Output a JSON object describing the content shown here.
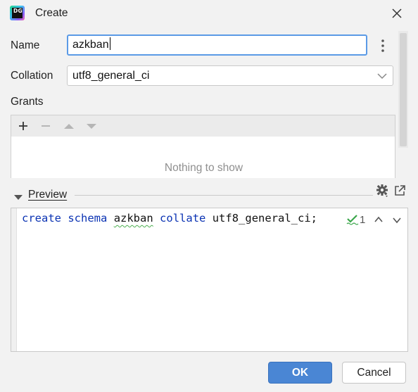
{
  "window": {
    "title": "Create",
    "app_logo_text": "DG"
  },
  "form": {
    "name_label": "Name",
    "name_value": "azkban",
    "collation_label": "Collation",
    "collation_value": "utf8_general_ci",
    "grants_label": "Grants"
  },
  "grants": {
    "toolbar": [
      "add-icon",
      "remove-icon",
      "move-up-icon",
      "move-down-icon"
    ],
    "empty_text": "Nothing to show"
  },
  "preview": {
    "label": "Preview",
    "code": {
      "kw1": "create",
      "kw2": "schema",
      "name": "azkban",
      "kw3": "collate",
      "rest": "utf8_general_ci;"
    },
    "inspection_count": "1"
  },
  "buttons": {
    "ok": "OK",
    "cancel": "Cancel"
  },
  "colors": {
    "accent": "#4a86d4",
    "keyword": "#0b33b3",
    "focus_border": "#5b9ae6"
  }
}
